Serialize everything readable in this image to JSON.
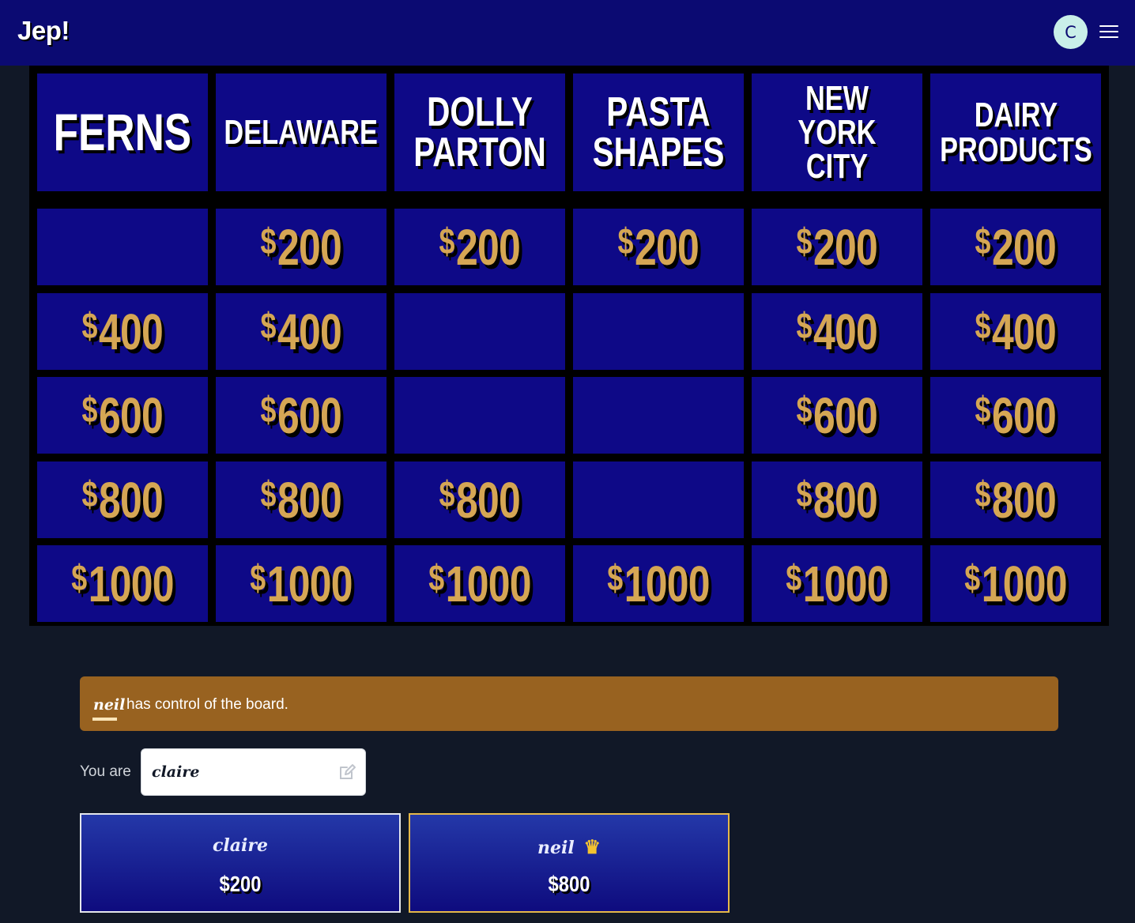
{
  "header": {
    "logo": "Jep!",
    "avatar_initial": "C"
  },
  "board": {
    "categories": [
      "FERNS",
      "DELAWARE",
      "DOLLY PARTON",
      "PASTA SHAPES",
      "NEW YORK CITY",
      "DAIRY PRODUCTS"
    ],
    "rows": [
      [
        "",
        "200",
        "200",
        "200",
        "200",
        "200"
      ],
      [
        "400",
        "400",
        "",
        "",
        "400",
        "400"
      ],
      [
        "600",
        "600",
        "",
        "",
        "600",
        "600"
      ],
      [
        "800",
        "800",
        "800",
        "",
        "800",
        "800"
      ],
      [
        "1000",
        "1000",
        "1000",
        "1000",
        "1000",
        "1000"
      ]
    ],
    "currency": "$"
  },
  "status": {
    "player": "neil",
    "message": "has control of the board."
  },
  "identity": {
    "label": "You are",
    "name": "claire"
  },
  "players": [
    {
      "name": "claire",
      "score": "$200",
      "crown": false
    },
    {
      "name": "neil",
      "score": "$800",
      "crown": true
    }
  ],
  "colors": {
    "board_cell": "#0e0987",
    "money": "#d5a654",
    "banner": "#986220",
    "header": "#0b0a72"
  }
}
